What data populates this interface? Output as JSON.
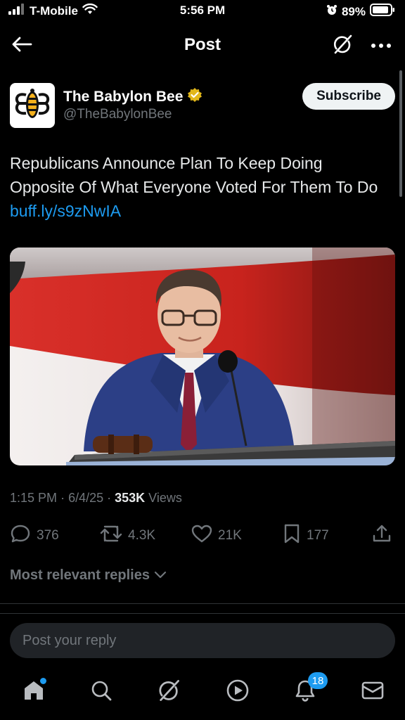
{
  "status_bar": {
    "carrier": "T-Mobile",
    "time": "5:56 PM",
    "battery": "89%"
  },
  "header": {
    "title": "Post"
  },
  "author": {
    "name": "The Babylon Bee",
    "handle": "@TheBabylonBee",
    "verified": true,
    "subscribe_label": "Subscribe"
  },
  "post": {
    "text": "Republicans Announce Plan To Keep Doing Opposite Of What Everyone Voted For Them To Do",
    "link": "buff.ly/s9zNwIA",
    "time": "1:15 PM",
    "date": "6/4/25",
    "views_count": "353K",
    "views_label": "Views"
  },
  "actions": {
    "replies": "376",
    "reposts": "4.3K",
    "likes": "21K",
    "bookmarks": "177"
  },
  "replies_sort": "Most relevant replies",
  "reply_box": {
    "placeholder": "Post your reply"
  },
  "tabbar": {
    "notifications_badge": "18"
  },
  "colors": {
    "accent": "#1d9bf0",
    "verified_gold": "#e2b719",
    "background": "#000000"
  },
  "icons": [
    "back-arrow-icon",
    "grok-icon",
    "more-icon",
    "verified-badge-icon",
    "reply-icon",
    "repost-icon",
    "like-icon",
    "bookmark-icon",
    "share-icon",
    "chevron-down-icon",
    "home-icon",
    "search-icon",
    "play-icon",
    "bell-icon",
    "mail-icon"
  ]
}
